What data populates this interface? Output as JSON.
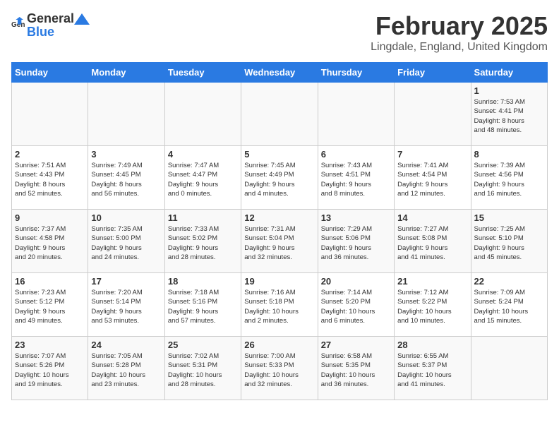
{
  "header": {
    "logo_general": "General",
    "logo_blue": "Blue",
    "main_title": "February 2025",
    "subtitle": "Lingdale, England, United Kingdom"
  },
  "calendar": {
    "days_of_week": [
      "Sunday",
      "Monday",
      "Tuesday",
      "Wednesday",
      "Thursday",
      "Friday",
      "Saturday"
    ],
    "weeks": [
      [
        {
          "day": "",
          "info": ""
        },
        {
          "day": "",
          "info": ""
        },
        {
          "day": "",
          "info": ""
        },
        {
          "day": "",
          "info": ""
        },
        {
          "day": "",
          "info": ""
        },
        {
          "day": "",
          "info": ""
        },
        {
          "day": "1",
          "info": "Sunrise: 7:53 AM\nSunset: 4:41 PM\nDaylight: 8 hours\nand 48 minutes."
        }
      ],
      [
        {
          "day": "2",
          "info": "Sunrise: 7:51 AM\nSunset: 4:43 PM\nDaylight: 8 hours\nand 52 minutes."
        },
        {
          "day": "3",
          "info": "Sunrise: 7:49 AM\nSunset: 4:45 PM\nDaylight: 8 hours\nand 56 minutes."
        },
        {
          "day": "4",
          "info": "Sunrise: 7:47 AM\nSunset: 4:47 PM\nDaylight: 9 hours\nand 0 minutes."
        },
        {
          "day": "5",
          "info": "Sunrise: 7:45 AM\nSunset: 4:49 PM\nDaylight: 9 hours\nand 4 minutes."
        },
        {
          "day": "6",
          "info": "Sunrise: 7:43 AM\nSunset: 4:51 PM\nDaylight: 9 hours\nand 8 minutes."
        },
        {
          "day": "7",
          "info": "Sunrise: 7:41 AM\nSunset: 4:54 PM\nDaylight: 9 hours\nand 12 minutes."
        },
        {
          "day": "8",
          "info": "Sunrise: 7:39 AM\nSunset: 4:56 PM\nDaylight: 9 hours\nand 16 minutes."
        }
      ],
      [
        {
          "day": "9",
          "info": "Sunrise: 7:37 AM\nSunset: 4:58 PM\nDaylight: 9 hours\nand 20 minutes."
        },
        {
          "day": "10",
          "info": "Sunrise: 7:35 AM\nSunset: 5:00 PM\nDaylight: 9 hours\nand 24 minutes."
        },
        {
          "day": "11",
          "info": "Sunrise: 7:33 AM\nSunset: 5:02 PM\nDaylight: 9 hours\nand 28 minutes."
        },
        {
          "day": "12",
          "info": "Sunrise: 7:31 AM\nSunset: 5:04 PM\nDaylight: 9 hours\nand 32 minutes."
        },
        {
          "day": "13",
          "info": "Sunrise: 7:29 AM\nSunset: 5:06 PM\nDaylight: 9 hours\nand 36 minutes."
        },
        {
          "day": "14",
          "info": "Sunrise: 7:27 AM\nSunset: 5:08 PM\nDaylight: 9 hours\nand 41 minutes."
        },
        {
          "day": "15",
          "info": "Sunrise: 7:25 AM\nSunset: 5:10 PM\nDaylight: 9 hours\nand 45 minutes."
        }
      ],
      [
        {
          "day": "16",
          "info": "Sunrise: 7:23 AM\nSunset: 5:12 PM\nDaylight: 9 hours\nand 49 minutes."
        },
        {
          "day": "17",
          "info": "Sunrise: 7:20 AM\nSunset: 5:14 PM\nDaylight: 9 hours\nand 53 minutes."
        },
        {
          "day": "18",
          "info": "Sunrise: 7:18 AM\nSunset: 5:16 PM\nDaylight: 9 hours\nand 57 minutes."
        },
        {
          "day": "19",
          "info": "Sunrise: 7:16 AM\nSunset: 5:18 PM\nDaylight: 10 hours\nand 2 minutes."
        },
        {
          "day": "20",
          "info": "Sunrise: 7:14 AM\nSunset: 5:20 PM\nDaylight: 10 hours\nand 6 minutes."
        },
        {
          "day": "21",
          "info": "Sunrise: 7:12 AM\nSunset: 5:22 PM\nDaylight: 10 hours\nand 10 minutes."
        },
        {
          "day": "22",
          "info": "Sunrise: 7:09 AM\nSunset: 5:24 PM\nDaylight: 10 hours\nand 15 minutes."
        }
      ],
      [
        {
          "day": "23",
          "info": "Sunrise: 7:07 AM\nSunset: 5:26 PM\nDaylight: 10 hours\nand 19 minutes."
        },
        {
          "day": "24",
          "info": "Sunrise: 7:05 AM\nSunset: 5:28 PM\nDaylight: 10 hours\nand 23 minutes."
        },
        {
          "day": "25",
          "info": "Sunrise: 7:02 AM\nSunset: 5:31 PM\nDaylight: 10 hours\nand 28 minutes."
        },
        {
          "day": "26",
          "info": "Sunrise: 7:00 AM\nSunset: 5:33 PM\nDaylight: 10 hours\nand 32 minutes."
        },
        {
          "day": "27",
          "info": "Sunrise: 6:58 AM\nSunset: 5:35 PM\nDaylight: 10 hours\nand 36 minutes."
        },
        {
          "day": "28",
          "info": "Sunrise: 6:55 AM\nSunset: 5:37 PM\nDaylight: 10 hours\nand 41 minutes."
        },
        {
          "day": "",
          "info": ""
        }
      ]
    ]
  }
}
